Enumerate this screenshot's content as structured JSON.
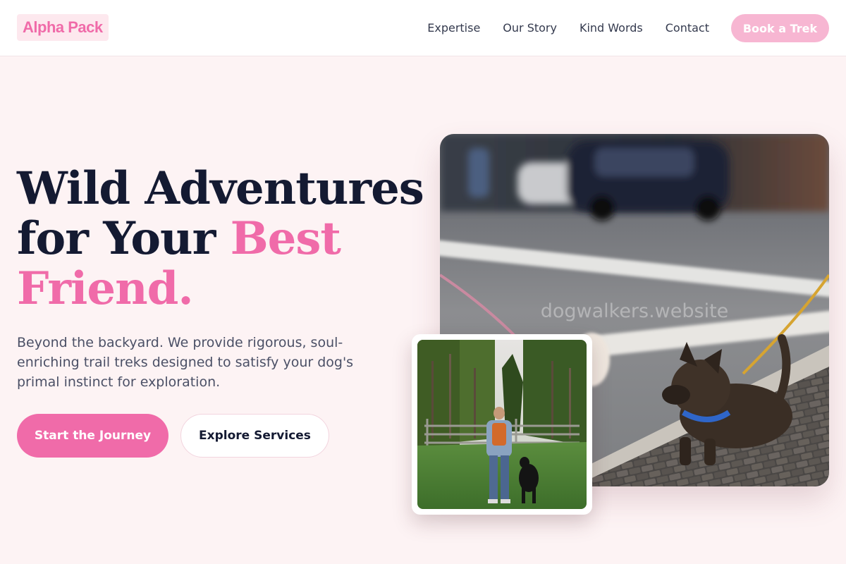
{
  "header": {
    "logo": "Alpha Pack",
    "nav": [
      "Expertise",
      "Our Story",
      "Kind Words",
      "Contact"
    ],
    "cta": "Book a Trek"
  },
  "hero": {
    "headline_part1": "Wild Adventures",
    "headline_part2": "for Your ",
    "headline_accent": "Best Friend.",
    "subtext": "Beyond the backyard. We provide rigorous, soul-enriching trail treks designed to satisfy your dog's primal instinct for exploration.",
    "primary_button": "Start the Journey",
    "secondary_button": "Explore Services"
  },
  "images": {
    "main_watermark": "dogwalkers.website"
  },
  "colors": {
    "accent": "#f06ba9",
    "accent_light": "#f7b6d2",
    "heading": "#141a32",
    "background": "#fdf3f4"
  }
}
